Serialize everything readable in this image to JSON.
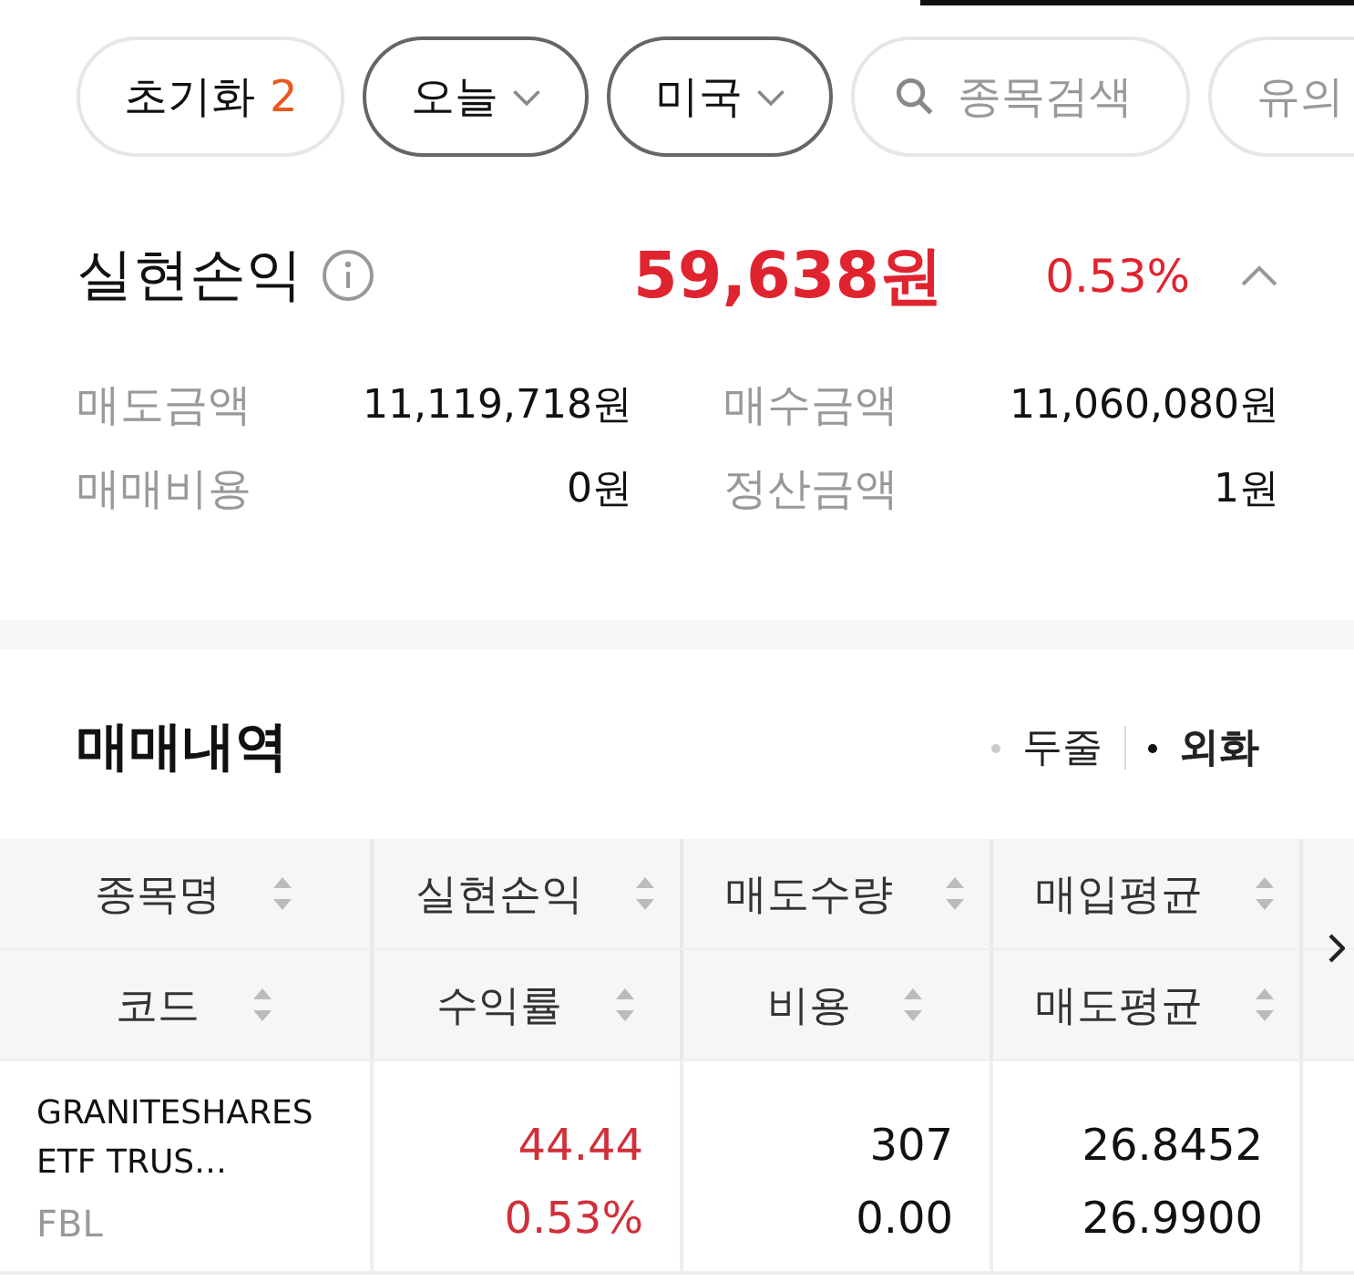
{
  "filters": [
    {
      "kind": "reset",
      "label": "초기화",
      "count": "2"
    },
    {
      "kind": "dropdown",
      "label": "오늘"
    },
    {
      "kind": "dropdown",
      "label": "미국"
    },
    {
      "kind": "search",
      "placeholder": "종목검색"
    },
    {
      "kind": "plain",
      "label": "유의"
    }
  ],
  "summary": {
    "title": "실현손익",
    "amount": "59,638원",
    "rate": "0.53%",
    "expanded": true,
    "items": [
      {
        "label": "매도금액",
        "value": "11,119,718원"
      },
      {
        "label": "매수금액",
        "value": "11,060,080원"
      },
      {
        "label": "매매비용",
        "value": "0원"
      },
      {
        "label": "정산금액",
        "value": "1원"
      }
    ]
  },
  "trades": {
    "title": "매매내역",
    "options": [
      {
        "label": "두줄",
        "selected": false
      },
      {
        "label": "외화",
        "selected": true
      }
    ],
    "columns": [
      [
        "종목명",
        "코드"
      ],
      [
        "실현손익",
        "수익률"
      ],
      [
        "매도수량",
        "비용"
      ],
      [
        "매입평균",
        "매도평균"
      ]
    ],
    "rows": [
      {
        "name": "GRANITESHARES ETF TRUS…",
        "code": "FBL",
        "pnl": "44.44",
        "rate": "0.53%",
        "qty": "307",
        "fee": "0.00",
        "buy_avg": "26.8452",
        "sell_avg": "26.9900"
      }
    ]
  }
}
